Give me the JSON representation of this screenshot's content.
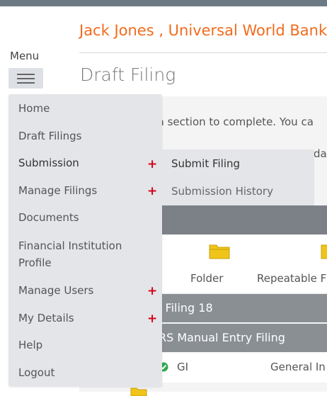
{
  "header": {
    "user_bank": "Jack Jones , Universal World Bank",
    "menu_label": "Menu",
    "page_title": "Draft Filing"
  },
  "menu": {
    "items": [
      {
        "label": "Home"
      },
      {
        "label": "Draft Filings"
      },
      {
        "label": "Submission",
        "expandable": true,
        "expanded": true
      },
      {
        "label": "Manage Filings",
        "expandable": true
      },
      {
        "label": "Documents"
      },
      {
        "label": "Financial Institution Profile"
      },
      {
        "label": "Manage Users",
        "expandable": true
      },
      {
        "label": "My Details",
        "expandable": true
      },
      {
        "label": "Help"
      },
      {
        "label": "Logout"
      }
    ],
    "plus_symbol": "+",
    "profile_line1": "Financial Institution",
    "profile_line2": "Profile",
    "submenu": [
      {
        "label": "Submit Filing"
      },
      {
        "label": "Submission History"
      }
    ]
  },
  "content": {
    "instruction_fragment": "t a section to complete. You ca",
    "second_fragment": "da",
    "tiles": [
      {
        "label": "Folder",
        "icon": "folder-icon"
      },
      {
        "label": "Repeatable F",
        "icon": "folder-icon"
      }
    ],
    "filings": [
      {
        "label": "l Filing 18"
      },
      {
        "label": "RS Manual Entry Filing"
      }
    ],
    "row": {
      "code": "GI",
      "description": "General In"
    }
  },
  "colors": {
    "accent": "#f26b1d",
    "plus": "#d0021b",
    "menu_bg": "#e3e5e8",
    "bar": "#8a8f94"
  }
}
